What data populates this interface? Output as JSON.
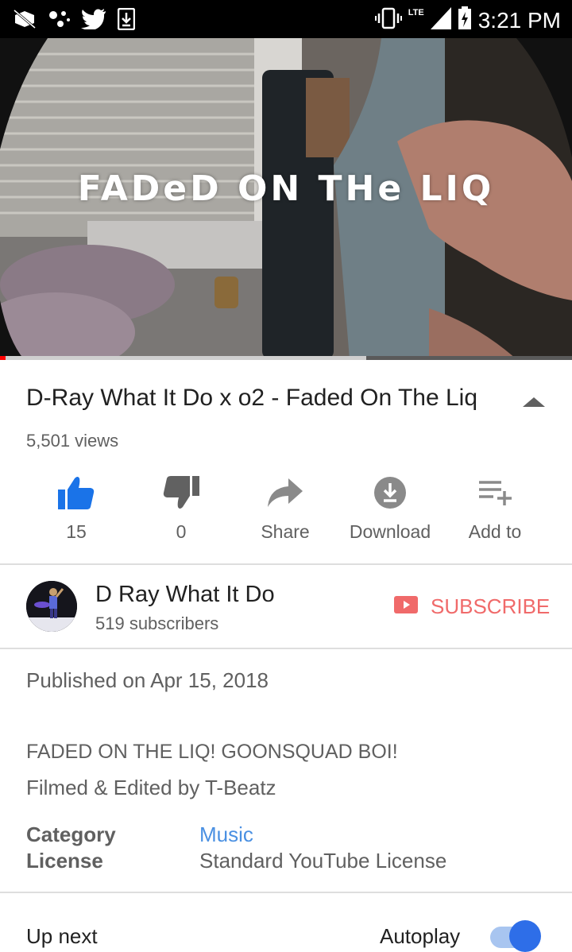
{
  "status_bar": {
    "time": "3:21 PM",
    "network": "LTE",
    "icons": [
      "no-sim-icon",
      "dots-icon",
      "twitter-icon",
      "download-icon",
      "vibrate-icon",
      "signal-icon",
      "battery-icon"
    ]
  },
  "video": {
    "overlay_title": "FADeD ON THe LIQ",
    "progress_fraction": 0.01,
    "buffered_fraction": 0.64
  },
  "info": {
    "title": "D-Ray What It Do x o2 - Faded On The Liq",
    "views": "5,501 views"
  },
  "actions": [
    {
      "label": "15",
      "icon": "thumb-up-icon"
    },
    {
      "label": "0",
      "icon": "thumb-down-icon"
    },
    {
      "label": "Share",
      "icon": "share-icon"
    },
    {
      "label": "Download",
      "icon": "download-circle-icon"
    },
    {
      "label": "Add to",
      "icon": "playlist-add-icon"
    }
  ],
  "channel": {
    "name": "D Ray What It Do",
    "subscribers": "519 subscribers",
    "subscribe_label": "SUBSCRIBE"
  },
  "description": {
    "published": "Published on Apr 15, 2018",
    "line1": "FADED ON THE LIQ! GOONSQUAD BOI!",
    "line2": "Filmed & Edited by T-Beatz",
    "category_label": "Category",
    "category_value": "Music",
    "license_label": "License",
    "license_value": "Standard YouTube License"
  },
  "up_next": {
    "label": "Up next",
    "autoplay_label": "Autoplay",
    "autoplay_on": true
  },
  "colors": {
    "accent_blue": "#1a73e8",
    "subscribe_red": "#f06a6a",
    "link_blue": "#4a90e2",
    "toggle_blue": "#2e6ee8"
  }
}
